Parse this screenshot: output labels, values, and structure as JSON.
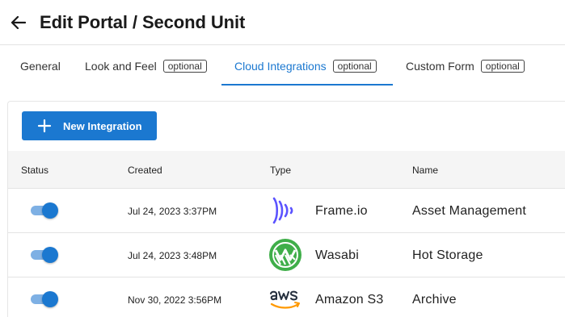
{
  "header": {
    "title": "Edit Portal / Second Unit"
  },
  "tabs": [
    {
      "label": "General",
      "badge": ""
    },
    {
      "label": "Look and Feel",
      "badge": "optional"
    },
    {
      "label": "Cloud Integrations",
      "badge": "optional",
      "active": true
    },
    {
      "label": "Custom Form",
      "badge": "optional"
    }
  ],
  "toolbar": {
    "new_integration_label": "New Integration"
  },
  "table": {
    "headers": {
      "status": "Status",
      "created": "Created",
      "type": "Type",
      "name": "Name"
    },
    "rows": [
      {
        "status_on": true,
        "created": "Jul 24, 2023 3:37PM",
        "type": "Frame.io",
        "type_icon": "frameio-logo-icon",
        "name": "Asset Management"
      },
      {
        "status_on": true,
        "created": "Jul 24, 2023 3:48PM",
        "type": "Wasabi",
        "type_icon": "wasabi-logo-icon",
        "name": "Hot Storage"
      },
      {
        "status_on": true,
        "created": "Nov 30, 2022 3:56PM",
        "type": "Amazon S3",
        "type_icon": "aws-logo-icon",
        "name": "Archive"
      }
    ]
  },
  "colors": {
    "accent": "#1b78d0",
    "toggle_track": "#7eb0e4",
    "frameio": "#5b53ff",
    "wasabi": "#3fae49",
    "aws_orange": "#ff9900"
  }
}
